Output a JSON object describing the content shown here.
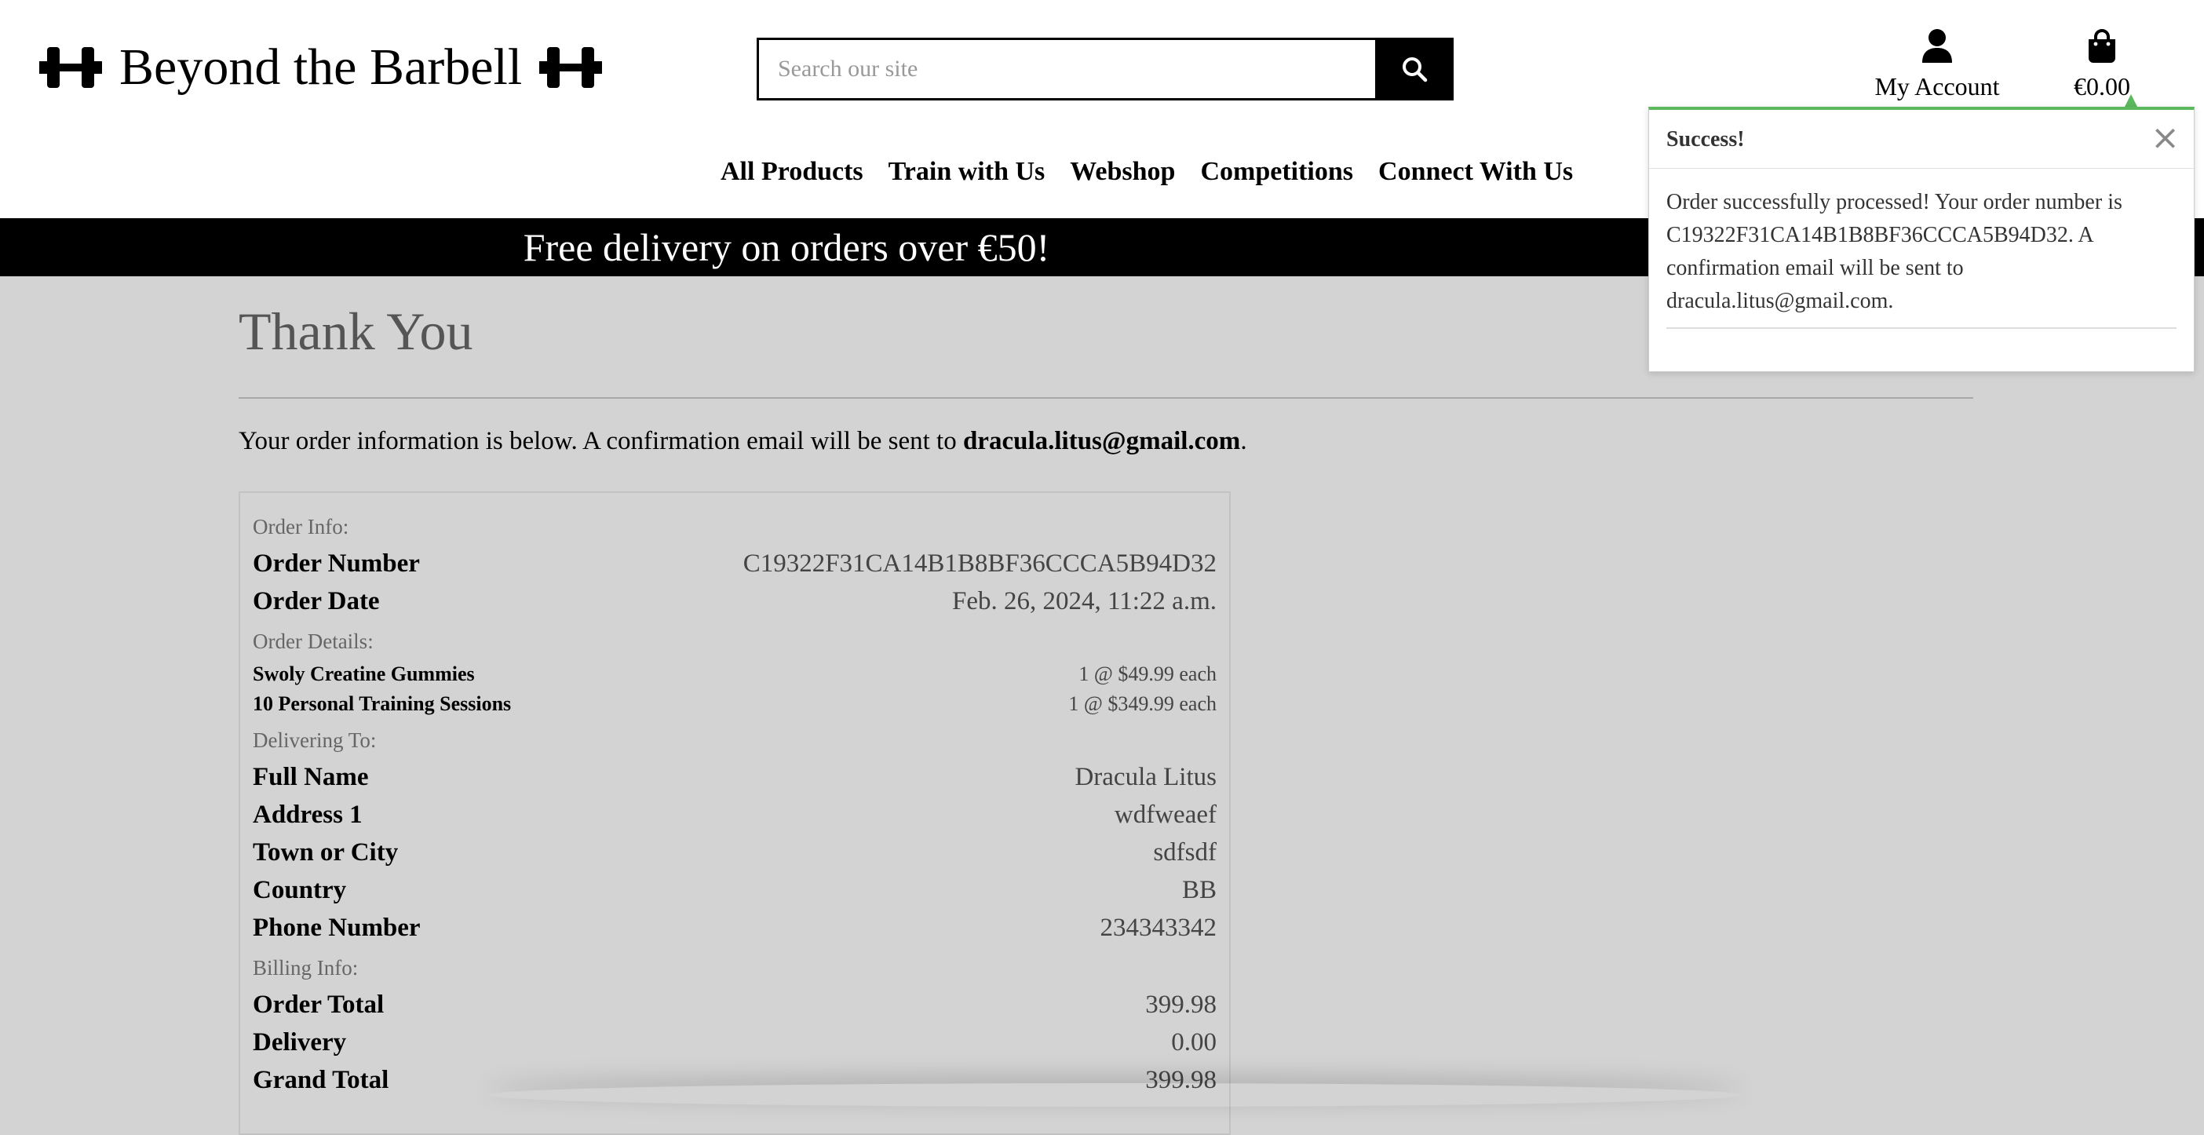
{
  "header": {
    "logo_text": "Beyond the Barbell",
    "search_placeholder": "Search our site",
    "account_label": "My Account",
    "cart_total": "€0.00"
  },
  "nav": {
    "items": [
      "All Products",
      "Train with Us",
      "Webshop",
      "Competitions",
      "Connect With Us"
    ]
  },
  "banner": {
    "text": "Free delivery on orders over €50!"
  },
  "page": {
    "title": "Thank You",
    "intro_prefix": "Your order information is below. A confirmation email will be sent to ",
    "intro_email": "dracula.litus@gmail.com",
    "intro_suffix": "."
  },
  "order": {
    "order_info_label": "Order Info:",
    "order_number_label": "Order Number",
    "order_number": "C19322F31CA14B1B8BF36CCCA5B94D32",
    "order_date_label": "Order Date",
    "order_date": "Feb. 26, 2024, 11:22 a.m.",
    "order_details_label": "Order Details:",
    "items": [
      {
        "name": "Swoly Creatine Gummies",
        "qty_price": "1 @ $49.99 each"
      },
      {
        "name": "10 Personal Training Sessions",
        "qty_price": "1 @ $349.99 each"
      }
    ],
    "delivering_label": "Delivering To:",
    "delivery": [
      {
        "label": "Full Name",
        "value": "Dracula Litus"
      },
      {
        "label": "Address 1",
        "value": "wdfweaef"
      },
      {
        "label": "Town or City",
        "value": "sdfsdf"
      },
      {
        "label": "Country",
        "value": "BB"
      },
      {
        "label": "Phone Number",
        "value": "234343342"
      }
    ],
    "billing_label": "Billing Info:",
    "billing": [
      {
        "label": "Order Total",
        "value": "399.98"
      },
      {
        "label": "Delivery",
        "value": "0.00"
      },
      {
        "label": "Grand Total",
        "value": "399.98"
      }
    ]
  },
  "toast": {
    "title": "Success!",
    "close_symbol": "×",
    "message": "Order successfully processed! Your order number is C19322F31CA14B1B8BF36CCCA5B94D32. A confirmation email will be sent to dracula.litus@gmail.com."
  },
  "colors": {
    "success_accent": "#5cb85c",
    "banner_bg": "#000000",
    "overlay_bg": "#d3d3d3"
  }
}
